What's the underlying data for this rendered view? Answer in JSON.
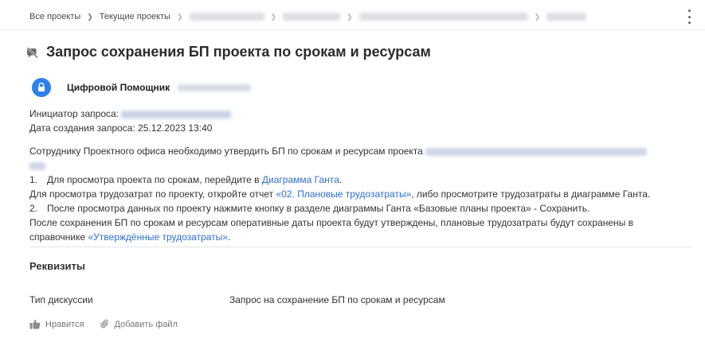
{
  "breadcrumb": {
    "items": [
      "Все проекты",
      "Текущие проекты"
    ]
  },
  "title": "Запрос сохранения БП проекта по срокам и ресурсам",
  "author": {
    "name": "Цифровой Помощник"
  },
  "meta": {
    "initiator_label": "Инициатор запроса:",
    "created_line": "Дата создания запроса: 25.12.2023 13:40"
  },
  "message": {
    "intro": "Сотруднику Проектного офиса необходимо утвердить БП по срокам и ресурсам проекта",
    "step1_num": "1.",
    "step1_text": "Для просмотра проекта по срокам, перейдите в ",
    "step1_link": "Диаграмма Ганта",
    "step1_end": ".",
    "costs_text": "Для просмотра трудозатрат по проекту, откройте отчет ",
    "costs_link": "«02. Плановые трудозатраты»",
    "costs_end": ", либо просмотрите трудозатраты в диаграмме Ганта.",
    "step2_num": "2.",
    "step2_text": "После просмотра данных по проекту нажмите кнопку в разделе диаграммы Ганта «Базовые планы проекта» - Сохранить.",
    "after_line1": "После сохранения БП по срокам и ресурсам оперативные даты проекта будут утверждены, плановые трудозатраты будут сохранены в",
    "after_line2": "справочнике ",
    "after_link": "«Утверждённые трудозатраты»",
    "after_end": "."
  },
  "requisites": {
    "title": "Реквизиты",
    "type_label": "Тип дискуссии",
    "type_value": "Запрос на сохранение БП по срокам и ресурсам"
  },
  "actions": {
    "like": "Нравится",
    "attach": "Добавить файл"
  },
  "colors": {
    "link": "#2f6fd0",
    "avatar": "#2f80ed"
  },
  "icons": [
    "chevron-right-icon",
    "kebab-menu-icon",
    "discussion-off-icon",
    "lock-bot-icon",
    "thumbs-up-icon",
    "paperclip-icon"
  ]
}
